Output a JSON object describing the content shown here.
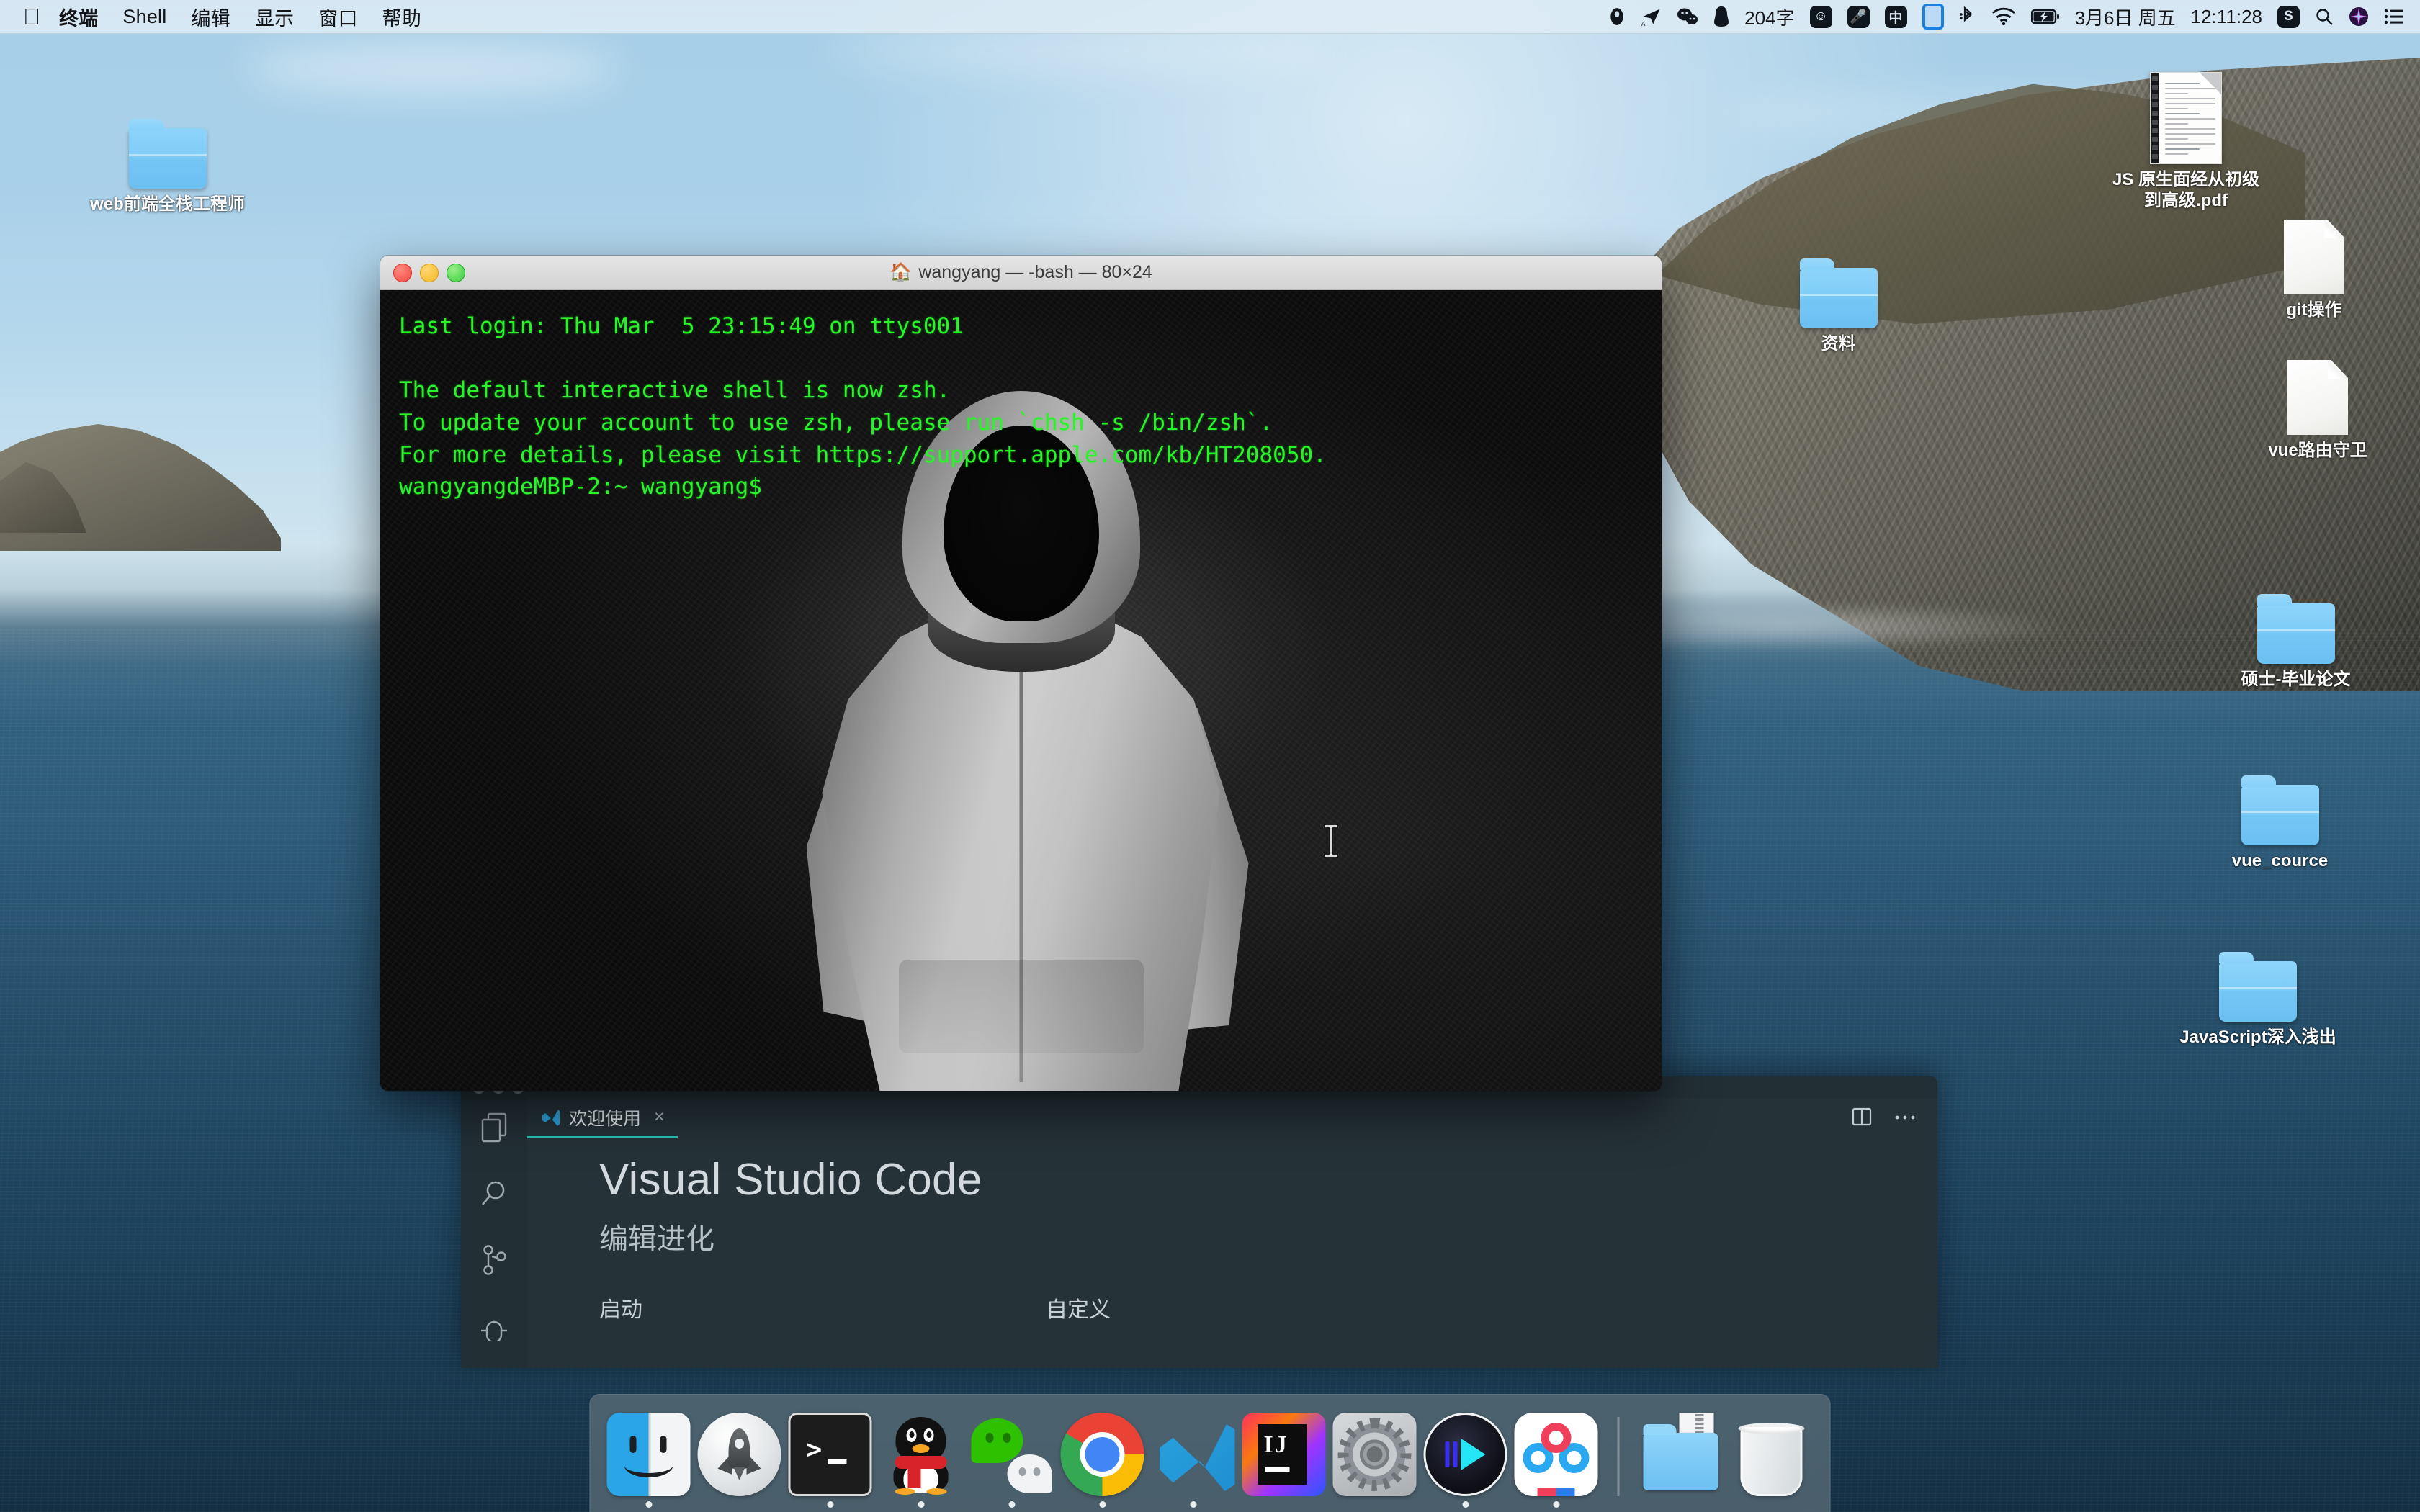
{
  "menubar": {
    "apple_glyph": "&#63743;",
    "items": [
      {
        "label": "终端",
        "name": "menu-terminal",
        "bold": true
      },
      {
        "label": "Shell",
        "name": "menu-shell",
        "bold": false
      },
      {
        "label": "编辑",
        "name": "menu-edit",
        "bold": false
      },
      {
        "label": "显示",
        "name": "menu-view",
        "bold": false
      },
      {
        "label": "窗口",
        "name": "menu-window",
        "bold": false
      },
      {
        "label": "帮助",
        "name": "menu-help",
        "bold": false
      }
    ],
    "status": {
      "char_count": "204字",
      "input_method": "中",
      "date": "3月6日 周五",
      "time": "12:11:28",
      "sogou_label": "S",
      "icons": [
        "dropbox-icon",
        "telegram-icon",
        "wechat-status-icon",
        "qq-status-icon",
        "emoji-icon",
        "mic-icon",
        "input-method-icon",
        "display-icon",
        "bluetooth-icon",
        "wifi-icon",
        "battery-charging-icon",
        "sogou-icon",
        "spotlight-search-icon",
        "siri-icon",
        "control-center-icon"
      ]
    }
  },
  "desktop_icons": [
    {
      "name": "web前端全栈工程师",
      "type": "folder"
    },
    {
      "name": "资料",
      "type": "folder"
    },
    {
      "name": "JS 原生面经从初级到高级.pdf",
      "type": "pdf",
      "line1": "JS 原生面经从初级",
      "line2": "到高级.pdf"
    },
    {
      "name": "git操作",
      "type": "document"
    },
    {
      "name": "vue路由守卫",
      "type": "document"
    },
    {
      "name": "硕士-毕业论文",
      "type": "folder"
    },
    {
      "name": "vue_cource",
      "type": "folder"
    },
    {
      "name": "JavaScript深入浅出",
      "type": "folder"
    }
  ],
  "terminal": {
    "title": "wangyang — -bash — 80×24",
    "home_glyph": "&#127968;",
    "content": "Last login: Thu Mar  5 23:15:49 on ttys001\n\nThe default interactive shell is now zsh.\nTo update your account to use zsh, please run `chsh -s /bin/zsh`.\nFor more details, please visit https://support.apple.com/kb/HT208050.\nwangyangdeMBP-2:~ wangyang$",
    "lines": [
      "Last login: Thu Mar  5 23:15:49 on ttys001",
      "",
      "The default interactive shell is now zsh.",
      "To update your account to use zsh, please run `chsh -s /bin/zsh`.",
      "For more details, please visit https://support.apple.com/kb/HT208050.",
      "wangyangdeMBP-2:~ wangyang$"
    ],
    "text_color": "#29f429",
    "background_color": "#000000"
  },
  "vscode": {
    "tab_label": "欢迎使用",
    "tab_close": "×",
    "title": "Visual Studio Code",
    "subtitle": "编辑进化",
    "col_left_heading": "启动",
    "col_right_heading": "自定义",
    "activity_icons": [
      "explorer-icon",
      "search-icon",
      "source-control-icon",
      "debug-icon"
    ],
    "tab_actions": [
      "split-editor-icon",
      "more-actions-icon"
    ],
    "accent_color": "#26c6b3"
  },
  "dock": {
    "items": [
      {
        "label": "访达",
        "name": "finder",
        "running": true
      },
      {
        "label": "启动台",
        "name": "launchpad",
        "running": false
      },
      {
        "label": "终端",
        "name": "terminal",
        "running": true
      },
      {
        "label": "QQ",
        "name": "qq",
        "running": true
      },
      {
        "label": "微信",
        "name": "wechat",
        "running": true
      },
      {
        "label": "Google Chrome",
        "name": "chrome",
        "running": true
      },
      {
        "label": "Visual Studio Code",
        "name": "vscode",
        "running": true
      },
      {
        "label": "IntelliJ IDEA",
        "name": "intellij-idea",
        "running": false
      },
      {
        "label": "系统偏好设置",
        "name": "system-preferences",
        "running": false
      },
      {
        "label": "IINA",
        "name": "iina",
        "running": true
      },
      {
        "label": "百度网盘",
        "name": "baidu-netdisk",
        "running": true
      },
      {
        "label": "下载",
        "name": "downloads-stack",
        "running": false
      },
      {
        "label": "废纸篓",
        "name": "trash",
        "running": false
      }
    ]
  }
}
